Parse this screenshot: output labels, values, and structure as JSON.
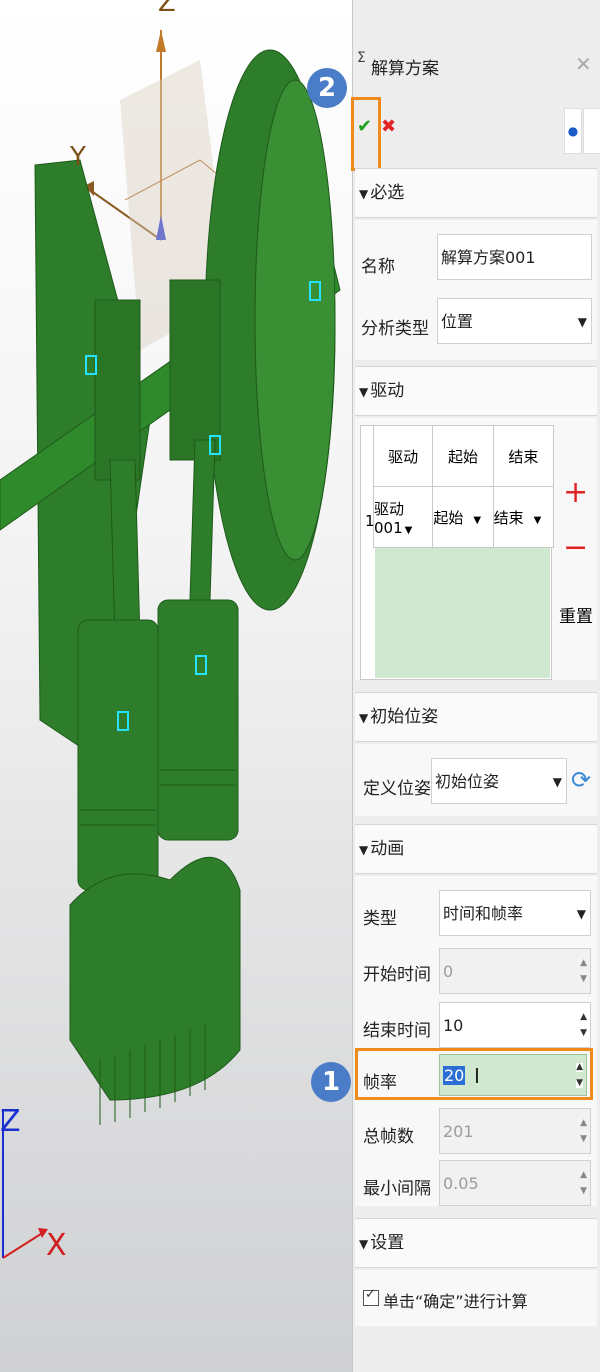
{
  "viewport": {
    "axis_top": {
      "z": "Z",
      "y": "Y"
    },
    "axis_bottom": {
      "z": "Z",
      "x": "X"
    },
    "badges": {
      "one": "1",
      "two": "2"
    }
  },
  "dialog": {
    "title": "解算方案",
    "ok_symbol": "✔",
    "cancel_symbol": "✖",
    "close_symbol": "✕",
    "required": {
      "header": "必选",
      "name_label": "名称",
      "name_value": "解算方案001",
      "type_label": "分析类型",
      "type_value": "位置"
    },
    "drive": {
      "header": "驱动",
      "columns": [
        "驱动",
        "起始",
        "结束"
      ],
      "rows": [
        {
          "index": "1",
          "drive": "驱动001",
          "start": "起始",
          "end": "结束"
        }
      ],
      "add_symbol": "+",
      "remove_symbol": "−",
      "reset_label": "重置"
    },
    "initial_pose": {
      "header": "初始位姿",
      "define_label": "定义位姿",
      "define_value": "初始位姿"
    },
    "animation": {
      "header": "动画",
      "type_label": "类型",
      "type_value": "时间和帧率",
      "start_label": "开始时间",
      "start_value": "0",
      "end_label": "结束时间",
      "end_value": "10",
      "rate_label": "帧率",
      "rate_value": "20",
      "frames_label": "总帧数",
      "frames_value": "201",
      "min_label": "最小间隔",
      "min_value": "0.05"
    },
    "settings": {
      "header": "设置",
      "confirm_label": "单击“确定”进行计算"
    }
  },
  "colors": {
    "model_green": "#2e7d2a",
    "accent_orange": "#f08a1c",
    "badge_blue": "#4a7cc7",
    "selection_green": "#cfe8cf"
  }
}
